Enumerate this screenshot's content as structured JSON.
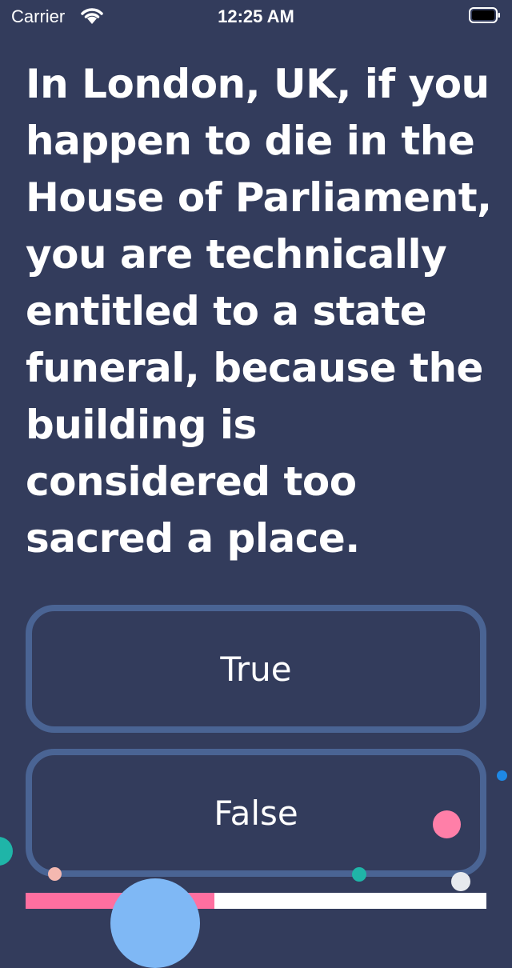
{
  "status_bar": {
    "carrier": "Carrier",
    "time": "12:25 AM"
  },
  "quiz": {
    "question": "In London, UK, if you happen to die in the House of Parliament, you are technically entitled to a state funeral, because the building is considered too sacred a place.",
    "answers": [
      {
        "label": "True"
      },
      {
        "label": "False"
      }
    ],
    "progress": 0.41
  },
  "colors": {
    "background": "#333c5c",
    "button_border": "#4a6494",
    "progress_fill": "#ff6fa0",
    "progress_track": "#ffffff",
    "bubble": "#7fb8f5",
    "dot_teal": "#1fb5a8",
    "dot_pink": "#ff7fa8",
    "dot_blue": "#1e88e5",
    "dot_light": "#e6e9ee",
    "dot_peach": "#f4b8b0"
  },
  "icons": {
    "wifi": "wifi-icon",
    "battery": "battery-icon"
  }
}
